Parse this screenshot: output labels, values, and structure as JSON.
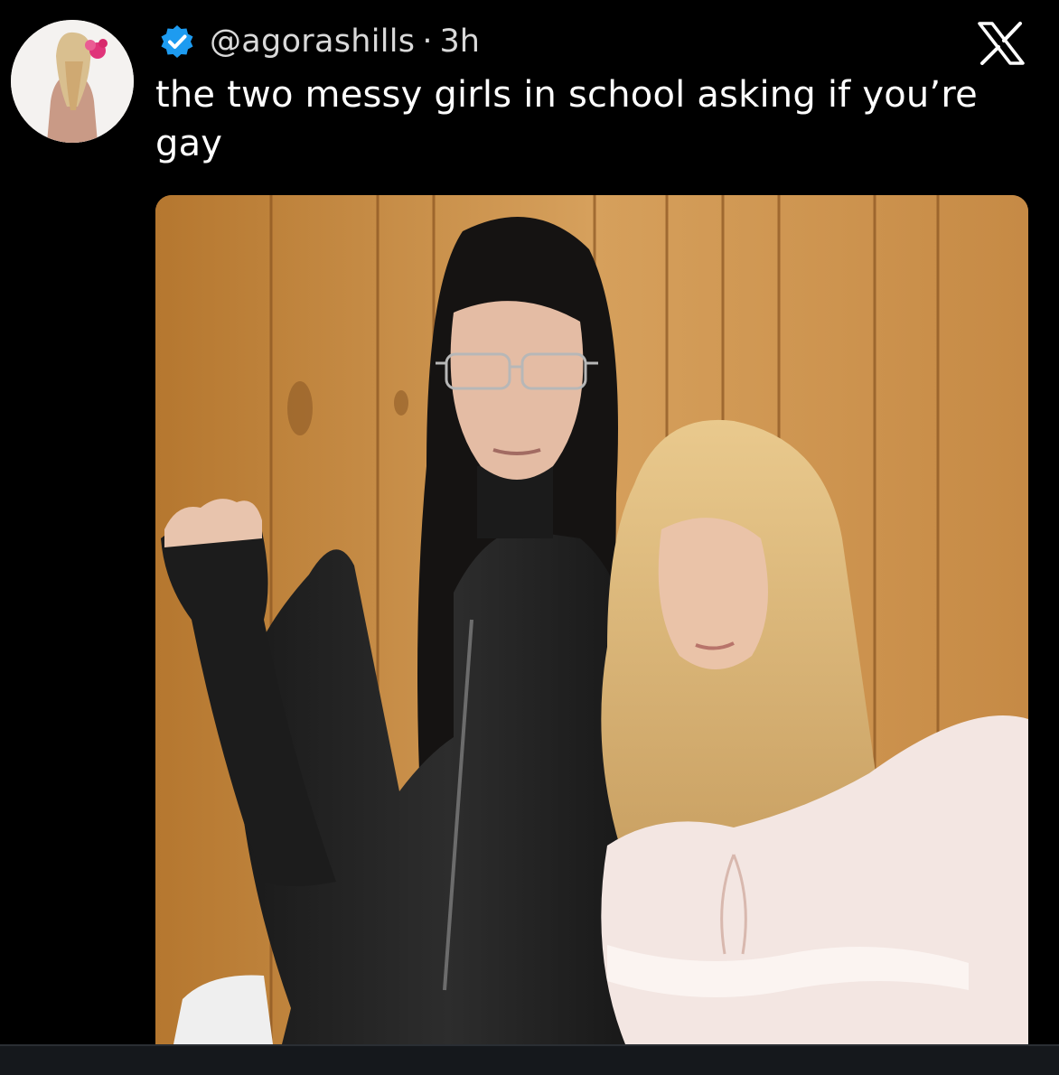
{
  "tweet": {
    "handle": "@agorashills",
    "separator": "·",
    "time": "3h",
    "text": "the two messy girls in school asking if you’re gay"
  },
  "icons": {
    "verified": "verified-badge-icon",
    "x_logo": "x-logo-icon"
  },
  "colors": {
    "background": "#000000",
    "text": "#ffffff",
    "secondary_text": "#d9d9d9",
    "verified_blue": "#1d9bf0"
  }
}
